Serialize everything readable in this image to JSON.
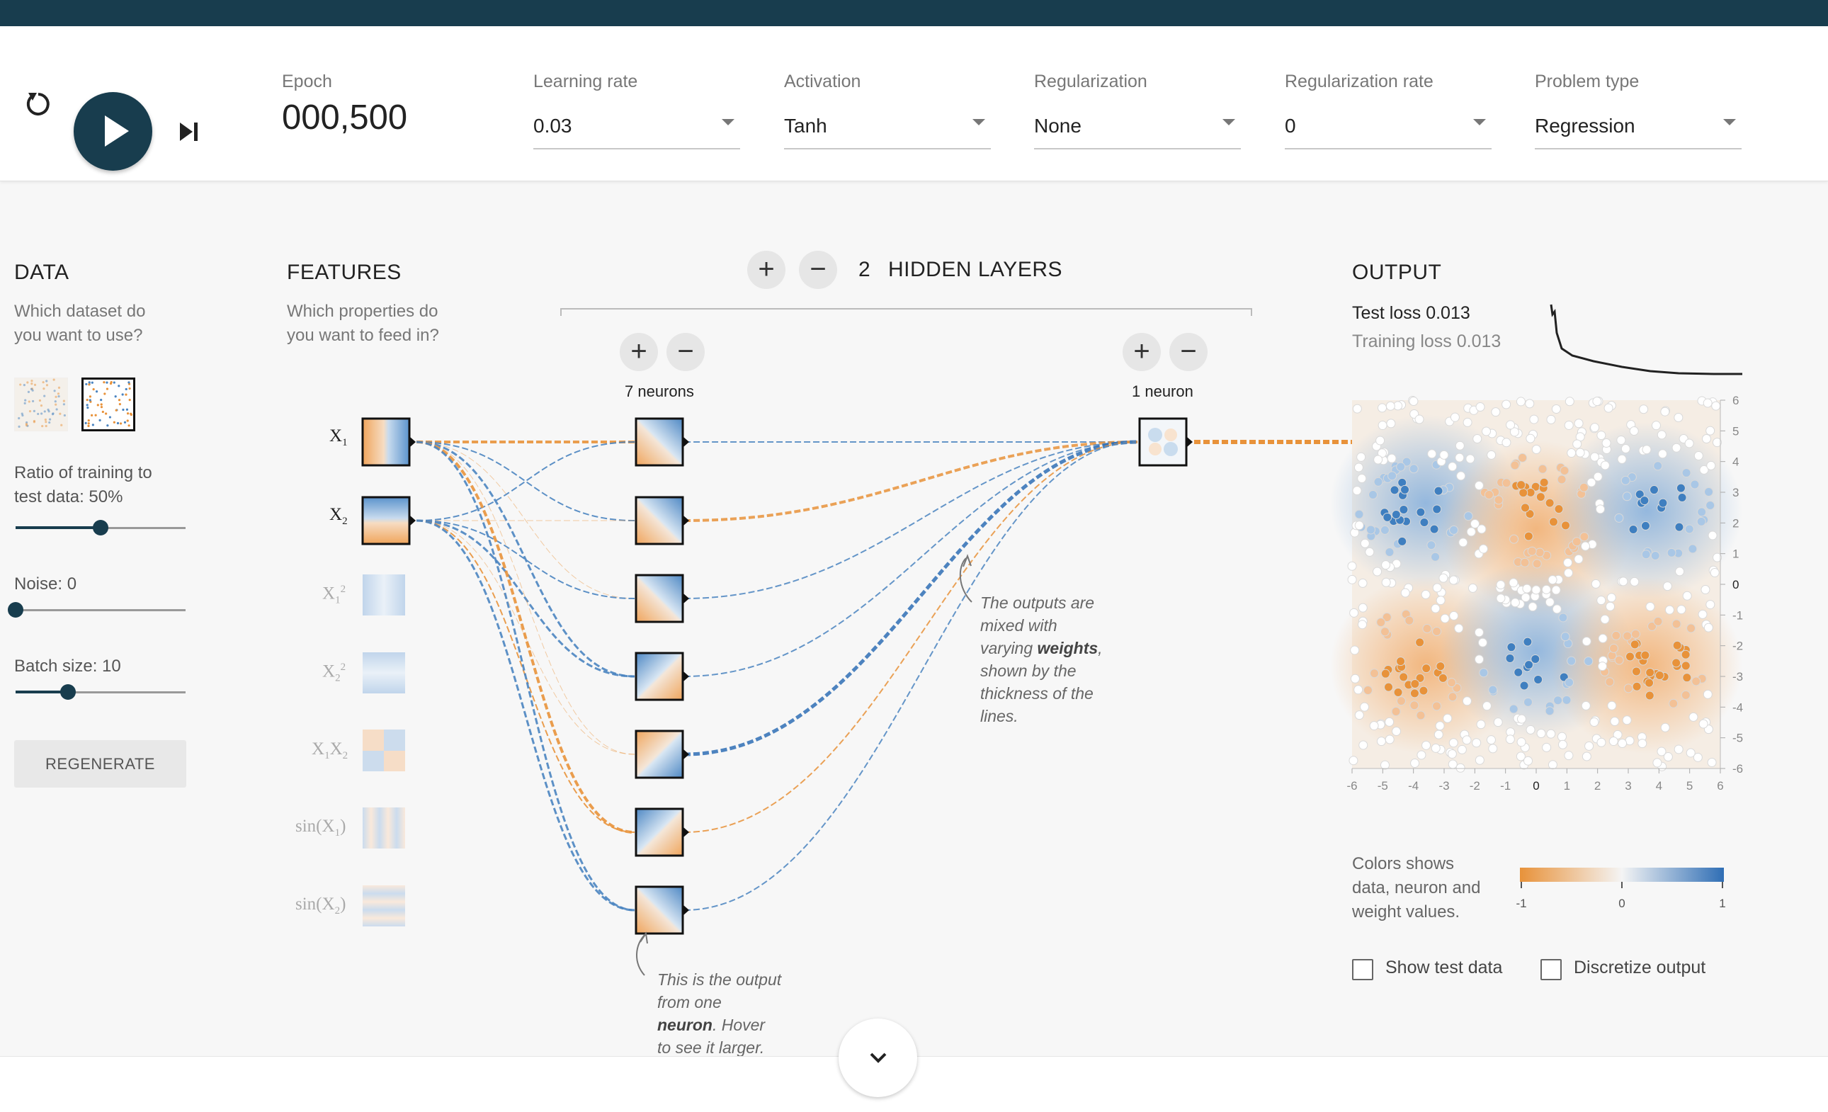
{
  "controls": {
    "epoch_label": "Epoch",
    "epoch_value": "000,500",
    "learning_rate": {
      "label": "Learning rate",
      "value": "0.03"
    },
    "activation": {
      "label": "Activation",
      "value": "Tanh"
    },
    "regularization": {
      "label": "Regularization",
      "value": "None"
    },
    "regularization_rate": {
      "label": "Regularization rate",
      "value": "0"
    },
    "problem_type": {
      "label": "Problem type",
      "value": "Regression"
    },
    "icons": [
      "reset-icon",
      "play-icon",
      "step-icon"
    ]
  },
  "data_panel": {
    "title": "DATA",
    "question": [
      "Which dataset do",
      "you want to use?"
    ],
    "ratio_label": [
      "Ratio of training to",
      "test data:  50%"
    ],
    "ratio_value": 0.5,
    "noise_label": "Noise:  0",
    "noise_value": 0,
    "batch_label": "Batch size:  10",
    "batch_value": 0.31,
    "regenerate": "REGENERATE"
  },
  "features_panel": {
    "title": "FEATURES",
    "question": [
      "Which properties do",
      "you want to feed in?"
    ],
    "features": [
      {
        "base": "X",
        "sub": "1",
        "sup": "",
        "active": true
      },
      {
        "base": "X",
        "sub": "2",
        "sup": "",
        "active": true
      },
      {
        "base": "X",
        "sub": "1",
        "sup": "2",
        "active": false
      },
      {
        "base": "X",
        "sub": "2",
        "sup": "2",
        "active": false
      },
      {
        "base": "X1X2",
        "sub": "",
        "sup": "",
        "active": false
      },
      {
        "base": "sin(X1)",
        "sub": "",
        "sup": "",
        "active": false
      },
      {
        "base": "sin(X2)",
        "sub": "",
        "sup": "",
        "active": false
      }
    ]
  },
  "network": {
    "hidden_count": "2",
    "hidden_title": "HIDDEN LAYERS",
    "layer1_label": "7 neurons",
    "layer2_label": "1 neuron",
    "annotation_weights": [
      "The outputs are",
      "mixed with",
      "varying weights,",
      "shown by the",
      "thickness of the",
      "lines."
    ],
    "annotation_neuron": [
      "This is the output",
      "from one",
      "neuron. Hover",
      "to see it larger."
    ]
  },
  "output_panel": {
    "title": "OUTPUT",
    "test_loss": "Test loss 0.013",
    "training_loss": "Training loss 0.013",
    "y_ticks": [
      "6",
      "5",
      "4",
      "3",
      "2",
      "1",
      "0",
      "-1",
      "-2",
      "-3",
      "-4",
      "-5",
      "-6"
    ],
    "x_ticks": [
      "-6",
      "-5",
      "-4",
      "-3",
      "-2",
      "-1",
      "0",
      "1",
      "2",
      "3",
      "4",
      "5",
      "6"
    ],
    "color_legend": [
      "Colors shows",
      "data, neuron and",
      "weight values."
    ],
    "legend_ticks": [
      "-1",
      "0",
      "1"
    ],
    "show_test_data": "Show test data",
    "discretize_output": "Discretize output"
  },
  "colors": {
    "orange": "#e8923a",
    "blue": "#3a78b8",
    "dark": "#183d4e"
  }
}
